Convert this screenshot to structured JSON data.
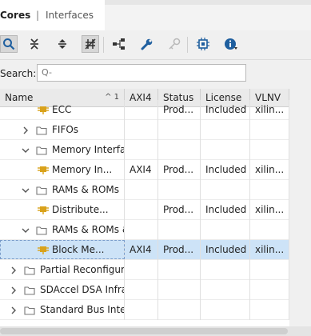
{
  "tabs": [
    {
      "label": "Cores"
    },
    {
      "label": "Interfaces"
    }
  ],
  "tab_separator": "|",
  "toolbar": {
    "icons": [
      "search-icon",
      "collapse-all-icon",
      "expand-all-icon",
      "filter-icon",
      "hierarchy-icon",
      "wrench-icon",
      "key-icon",
      "chip-icon",
      "info-icon"
    ]
  },
  "search": {
    "label": "Search:",
    "placeholder": "Q-"
  },
  "table": {
    "columns": [
      "Name",
      "AXI4",
      "Status",
      "License",
      "VLNV"
    ],
    "sort_indicator": "^ 1",
    "rows": [
      {
        "type": "leaf",
        "level": 2,
        "name": "ECC",
        "axi4": "",
        "status": "Prod...",
        "license": "Included",
        "vlnv": "xilin..."
      },
      {
        "type": "folder",
        "level": 1,
        "expanded": false,
        "name": "FIFOs",
        "axi4": "",
        "status": "",
        "license": "",
        "vlnv": ""
      },
      {
        "type": "folder",
        "level": 1,
        "expanded": true,
        "name": "Memory Interface Generators",
        "axi4": "",
        "status": "",
        "license": "",
        "vlnv": ""
      },
      {
        "type": "leaf",
        "level": 2,
        "name": "Memory In...",
        "axi4": "AXI4",
        "status": "Prod...",
        "license": "Included",
        "vlnv": "xilin..."
      },
      {
        "type": "folder",
        "level": 1,
        "expanded": true,
        "name": "RAMs & ROMs",
        "axi4": "",
        "status": "",
        "license": "",
        "vlnv": ""
      },
      {
        "type": "leaf",
        "level": 2,
        "name": "Distribute...",
        "axi4": "",
        "status": "Prod...",
        "license": "Included",
        "vlnv": "xilin..."
      },
      {
        "type": "folder",
        "level": 1,
        "expanded": true,
        "name": "RAMs & ROMs & BRAM",
        "axi4": "",
        "status": "",
        "license": "",
        "vlnv": ""
      },
      {
        "type": "leaf",
        "level": 2,
        "selected": true,
        "name": "Block Me...",
        "axi4": "AXI4",
        "status": "Prod...",
        "license": "Included",
        "vlnv": "xilin..."
      },
      {
        "type": "folder",
        "level": 0,
        "expanded": false,
        "name": "Partial Reconfiguration",
        "axi4": "",
        "status": "",
        "license": "",
        "vlnv": ""
      },
      {
        "type": "folder",
        "level": 0,
        "expanded": false,
        "name": "SDAccel DSA Infrastructure",
        "axi4": "",
        "status": "",
        "license": "",
        "vlnv": ""
      },
      {
        "type": "folder",
        "level": 0,
        "expanded": false,
        "name": "Standard Bus Interfaces",
        "axi4": "",
        "status": "",
        "license": "",
        "vlnv": ""
      }
    ]
  },
  "colors": {
    "selection": "#cde3f7",
    "ip_icon": "#d9a21b",
    "folder": "#777777"
  }
}
